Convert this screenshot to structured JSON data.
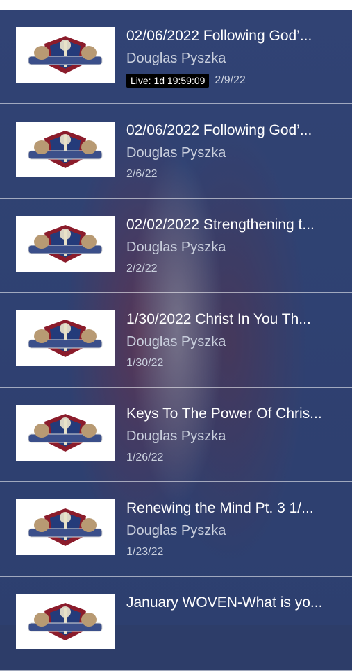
{
  "items": [
    {
      "title": "02/06/2022 Following God’...",
      "author": "Douglas Pyszka",
      "live": "Live: 1d 19:59:09",
      "date": "2/9/22"
    },
    {
      "title": "02/06/2022 Following God’...",
      "author": "Douglas Pyszka",
      "date": "2/6/22"
    },
    {
      "title": "02/02/2022 Strengthening t...",
      "author": "Douglas Pyszka",
      "date": "2/2/22"
    },
    {
      "title": "1/30/2022 Christ In You Th...",
      "author": "Douglas Pyszka",
      "date": "1/30/22"
    },
    {
      "title": "Keys To The Power Of Chris...",
      "author": "Douglas Pyszka",
      "date": "1/26/22"
    },
    {
      "title": "Renewing the Mind Pt. 3 1/...",
      "author": "Douglas Pyszka",
      "date": "1/23/22"
    },
    {
      "title": "January WOVEN-What is yo...",
      "author": "",
      "date": ""
    }
  ],
  "logo_icon": "shield-crest-logo"
}
